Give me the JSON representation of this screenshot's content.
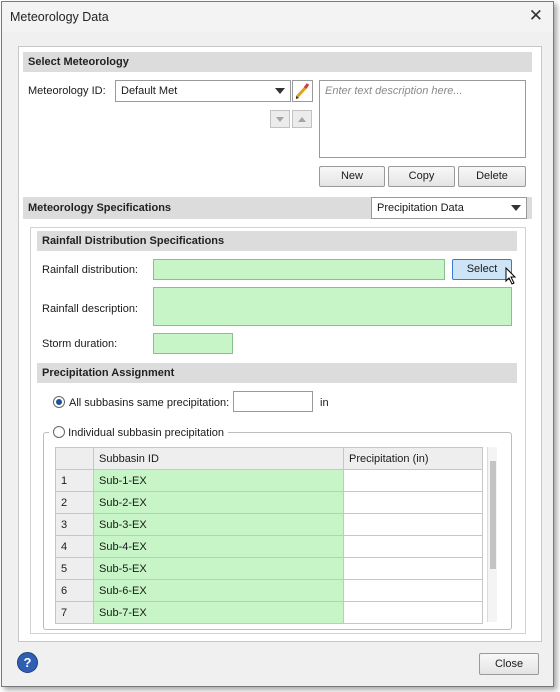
{
  "window": {
    "title": "Meteorology Data"
  },
  "select_met": {
    "header": "Select Meteorology",
    "id_label": "Meteorology ID:",
    "id_value": "Default Met",
    "description_placeholder": "Enter text description here...",
    "buttons": {
      "new": "New",
      "copy": "Copy",
      "delete": "Delete"
    }
  },
  "met_specs": {
    "header": "Meteorology Specifications",
    "type_value": "Precipitation Data"
  },
  "rainfall": {
    "header": "Rainfall Distribution Specifications",
    "distribution_label": "Rainfall distribution:",
    "distribution_value": "",
    "select_button": "Select",
    "description_label": "Rainfall description:",
    "description_value": "",
    "duration_label": "Storm duration:",
    "duration_value": ""
  },
  "precip": {
    "header": "Precipitation Assignment",
    "same_label": "All subbasins same precipitation:",
    "same_value": "",
    "same_unit": "in",
    "individual_label": "Individual subbasin precipitation",
    "selected_option": "All subbasins same precipitation",
    "columns": [
      "Subbasin ID",
      "Precipitation (in)"
    ],
    "rows": [
      {
        "num": "1",
        "id": "Sub-1-EX",
        "precip": ""
      },
      {
        "num": "2",
        "id": "Sub-2-EX",
        "precip": ""
      },
      {
        "num": "3",
        "id": "Sub-3-EX",
        "precip": ""
      },
      {
        "num": "4",
        "id": "Sub-4-EX",
        "precip": ""
      },
      {
        "num": "5",
        "id": "Sub-5-EX",
        "precip": ""
      },
      {
        "num": "6",
        "id": "Sub-6-EX",
        "precip": ""
      },
      {
        "num": "7",
        "id": "Sub-7-EX",
        "precip": ""
      }
    ]
  },
  "footer": {
    "help_icon": "?",
    "close_button": "Close"
  },
  "colors": {
    "green_field": "#c7f5c7",
    "select_highlight": "#cde4f7",
    "section_bar": "#dcdcdc"
  },
  "icons": [
    "close-icon",
    "pencil-icon",
    "dropdown-arrow-icon",
    "move-down-icon",
    "move-up-icon",
    "help-icon",
    "mouse-cursor-icon"
  ]
}
